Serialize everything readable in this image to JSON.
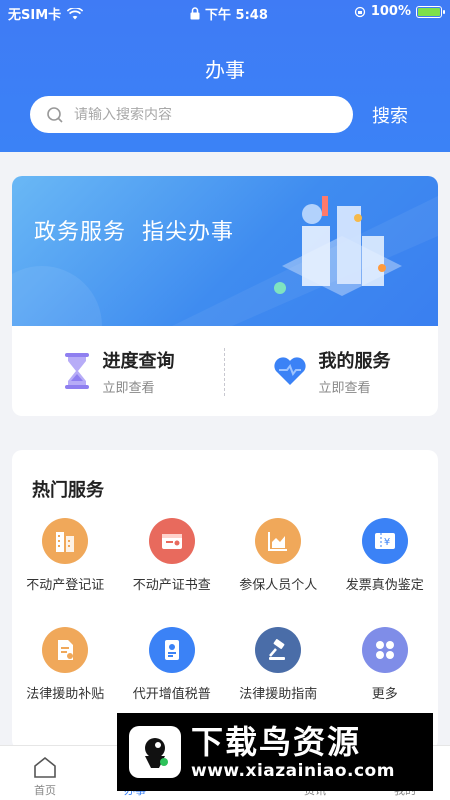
{
  "status_bar": {
    "carrier": "无SIM卡",
    "time": "下午 5:48",
    "battery": "100%"
  },
  "header": {
    "title": "办事",
    "search_placeholder": "请输入搜索内容",
    "search_button": "搜索"
  },
  "banner": {
    "slogan_1": "政务服务",
    "slogan_2": "指尖办事"
  },
  "quick_actions": [
    {
      "title": "进度查询",
      "subtitle": "立即查看",
      "icon": "hourglass-icon",
      "color": "#8f7ff0"
    },
    {
      "title": "我的服务",
      "subtitle": "立即查看",
      "icon": "heart-icon",
      "color": "#3b82f6"
    }
  ],
  "services": {
    "title": "热门服务",
    "items": [
      {
        "label": "不动产登记证",
        "icon": "building-icon",
        "color": "#f0a85a"
      },
      {
        "label": "不动产证书查",
        "icon": "certificate-icon",
        "color": "#e86a5d"
      },
      {
        "label": "参保人员个人",
        "icon": "chart-icon",
        "color": "#f0a85a"
      },
      {
        "label": "发票真伪鉴定",
        "icon": "invoice-icon",
        "color": "#3b82f6"
      },
      {
        "label": "法律援助补贴",
        "icon": "document-icon",
        "color": "#f0a85a"
      },
      {
        "label": "代开增值税普",
        "icon": "tax-form-icon",
        "color": "#3b82f6"
      },
      {
        "label": "法律援助指南",
        "icon": "gavel-icon",
        "color": "#4a6da8"
      },
      {
        "label": "更多",
        "icon": "more-icon",
        "color": "#7f8de8"
      }
    ]
  },
  "tabbar": {
    "items": [
      {
        "label": "首页",
        "icon": "home-icon"
      },
      {
        "label": "办事",
        "icon": "service-icon"
      },
      {
        "label": "",
        "icon": "center-icon"
      },
      {
        "label": "资讯",
        "icon": "news-icon"
      },
      {
        "label": "我的",
        "icon": "profile-icon"
      }
    ]
  },
  "watermark": {
    "title": "下载鸟资源",
    "url": "www.xiazainiao.com"
  }
}
